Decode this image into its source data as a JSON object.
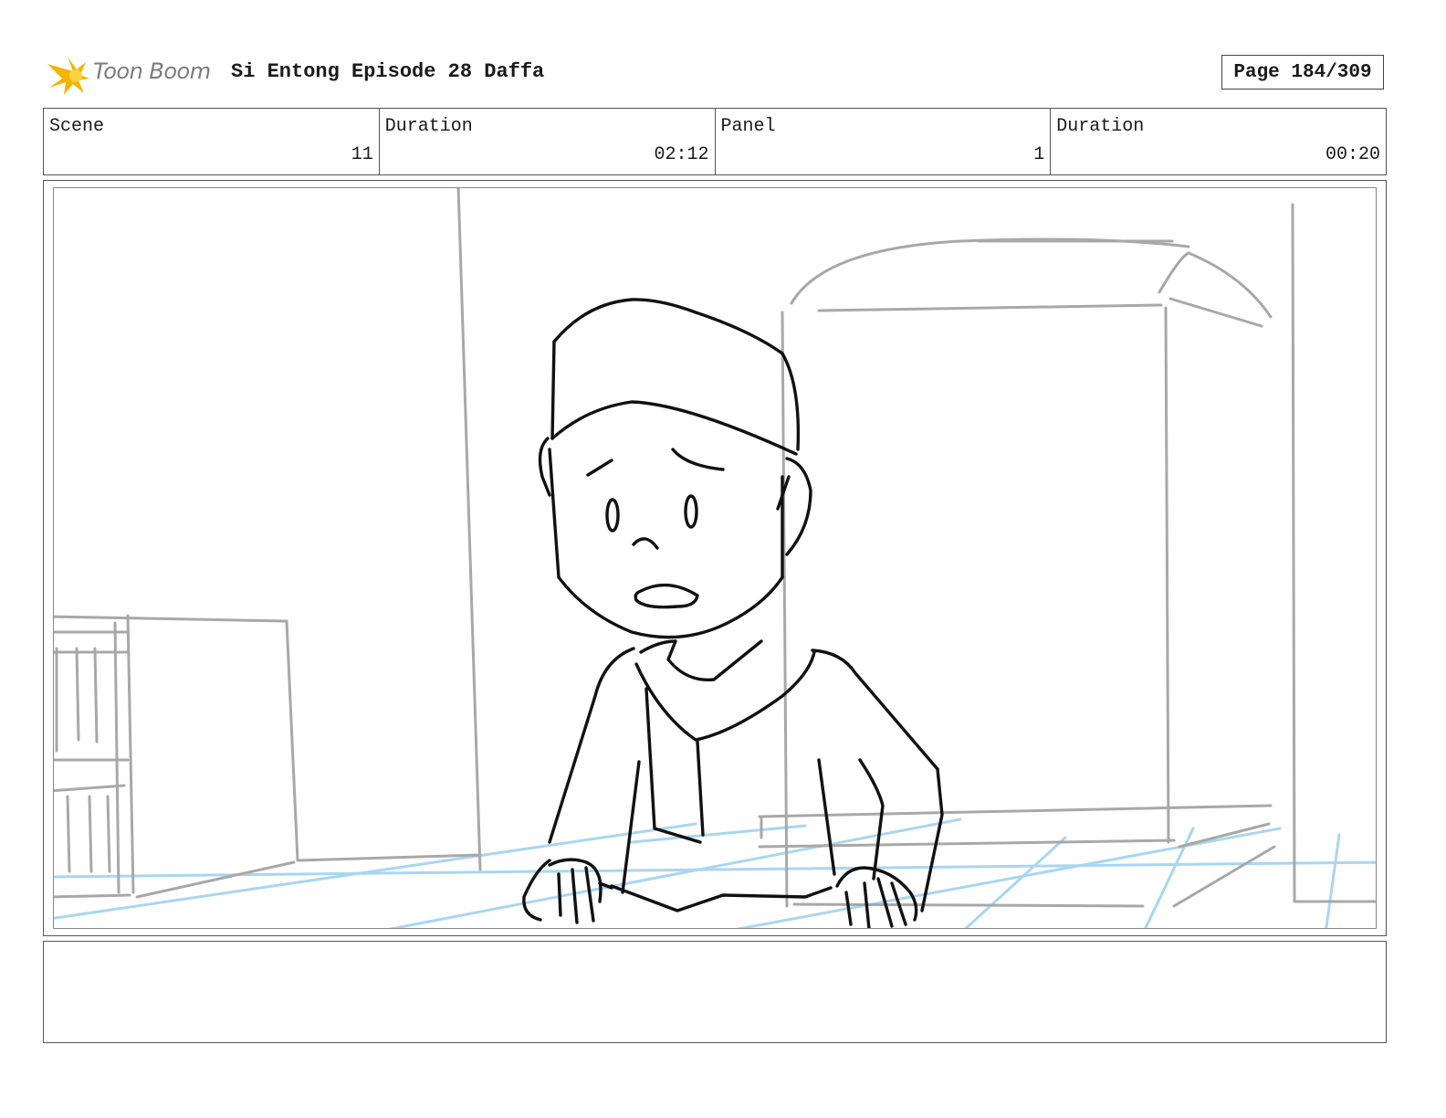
{
  "header": {
    "logo_text": "Toon Boom",
    "title": "Si Entong Episode 28 Daffa",
    "page_label": "Page 184/309"
  },
  "info": {
    "scene_label": "Scene",
    "scene_value": "11",
    "scene_duration_label": "Duration",
    "scene_duration_value": "02:12",
    "panel_label": "Panel",
    "panel_value": "1",
    "panel_duration_label": "Duration",
    "panel_duration_value": "00:20"
  },
  "colors": {
    "logo_star": "#f4b400",
    "sketch_ink": "#111111",
    "background_lines": "#a8a8a8",
    "floor_grid": "#a9d6f2"
  },
  "notes": {
    "text": ""
  }
}
